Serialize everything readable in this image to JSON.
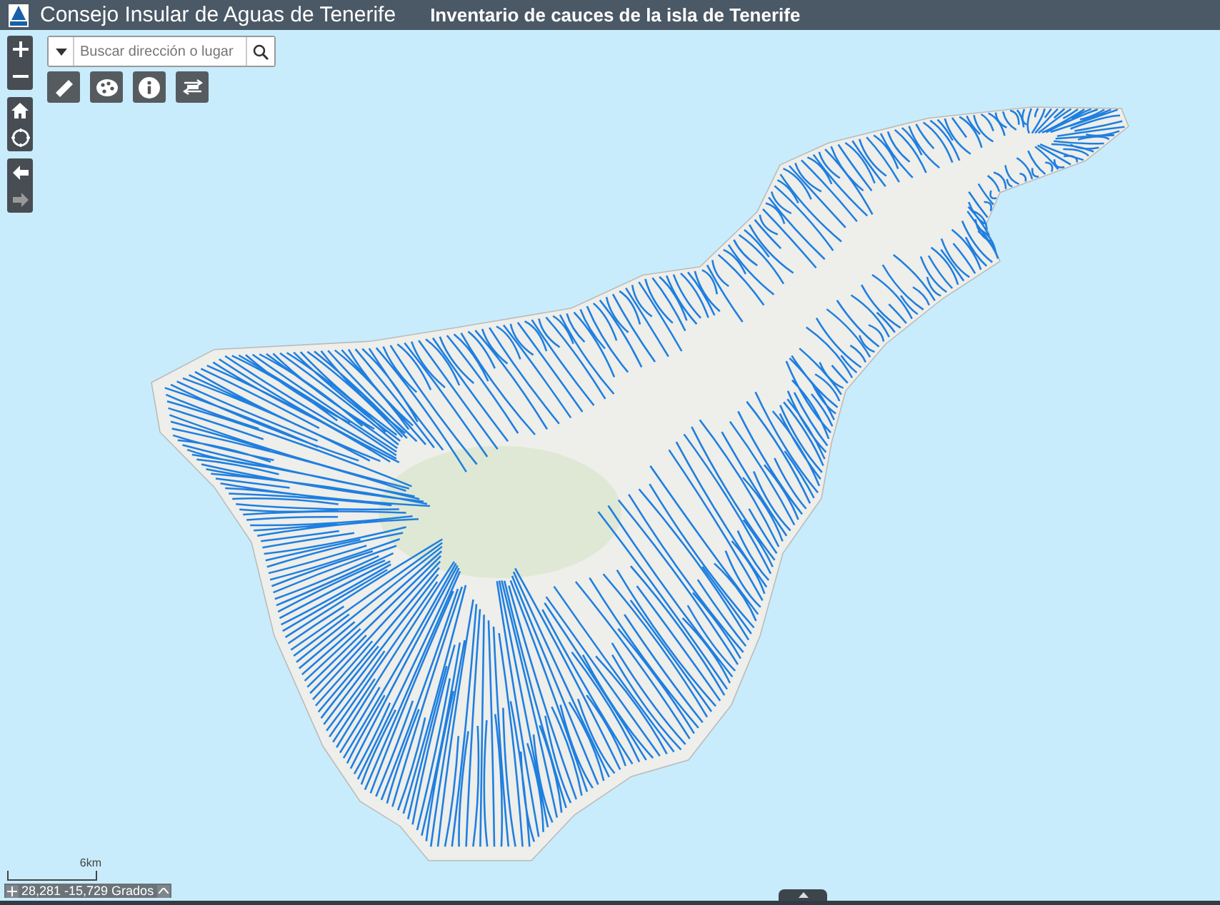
{
  "header": {
    "title": "Consejo Insular de Aguas de Tenerife",
    "subtitle": "Inventario de cauces de la isla de Tenerife"
  },
  "zoom_controls": [
    {
      "kind": "zoom-in",
      "disabled": false
    },
    {
      "kind": "zoom-out",
      "disabled": false
    }
  ],
  "view_controls": [
    {
      "kind": "home",
      "disabled": false
    },
    {
      "kind": "locate",
      "disabled": false
    }
  ],
  "navigation": [
    {
      "kind": "back",
      "disabled": false
    },
    {
      "kind": "forward",
      "disabled": true
    }
  ],
  "search": {
    "placeholder": "Buscar dirección o lugar"
  },
  "tools": [
    {
      "kind": "measure"
    },
    {
      "kind": "basemap"
    },
    {
      "kind": "info"
    },
    {
      "kind": "coordinates"
    }
  ],
  "scale": {
    "label": "6km"
  },
  "coordinates": {
    "text": "28,281 -15,729 Grados"
  }
}
